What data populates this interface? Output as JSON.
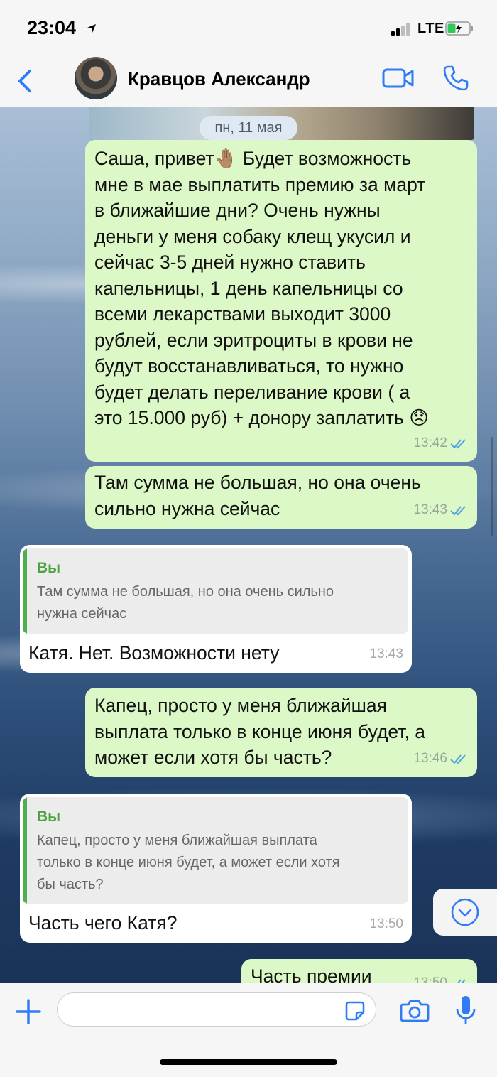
{
  "status_bar": {
    "time": "23:04",
    "network": "LTE"
  },
  "header": {
    "contact_name": "Кравцов Александр"
  },
  "date_label": "пн, 11 мая",
  "messages": [
    {
      "direction": "out",
      "text": "Саша, привет🤚🏽   Будет возможность\nмне в мае выплатить премию за март\nв ближайшие дни? Очень нужны\nденьги у меня собаку клещ укусил и\nсейчас 3-5 дней нужно ставить\nкапельницы, 1 день капельницы со\nвсеми лекарствами выходит 3000\nрублей, если эритроциты в крови не\nбудут восстанавливаться, то нужно\nбудет делать переливание крови ( а\nэто 15.000 руб) + донору заплатить 😞",
      "time": "13:42",
      "status": "read"
    },
    {
      "direction": "out",
      "text": "Там сумма не большая, но она очень\nсильно нужна сейчас",
      "time": "13:43",
      "status": "read"
    },
    {
      "direction": "in",
      "quote_author": "Вы",
      "quote_text": "Там сумма не большая, но она очень сильно\nнужна сейчас",
      "text": "Катя. Нет. Возможности нету",
      "time": "13:43"
    },
    {
      "direction": "out",
      "text": "Капец, просто у меня ближайшая\nвыплата только в конце июня будет, а\nможет если хотя бы часть?",
      "time": "13:46",
      "status": "read"
    },
    {
      "direction": "in",
      "quote_author": "Вы",
      "quote_text": "Капец, просто у меня ближайшая выплата\nтолько в конце июня будет, а может если хотя\nбы часть?",
      "text": "Часть чего Катя?",
      "time": "13:50"
    },
    {
      "direction": "out",
      "text": "Часть премии",
      "time": "13:50",
      "status": "read"
    }
  ],
  "input": {
    "value": "",
    "placeholder": ""
  },
  "colors": {
    "accent": "#2f7cf6",
    "outgoing_bubble": "#dcf8c6",
    "incoming_bubble": "#ffffff",
    "read_ticks": "#4fa3e0",
    "quote_author": "#4aa33e"
  }
}
